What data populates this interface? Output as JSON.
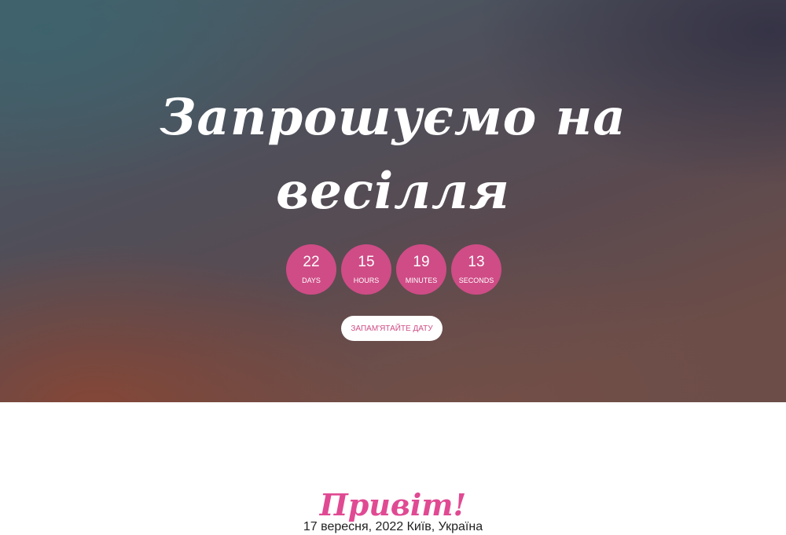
{
  "hero": {
    "title": "Запрошуємо на весілля",
    "countdown": [
      {
        "value": "22",
        "label": "DAYS"
      },
      {
        "value": "15",
        "label": "HOURS"
      },
      {
        "value": "19",
        "label": "MINUTES"
      },
      {
        "value": "13",
        "label": "SECONDS"
      }
    ],
    "button_label": "Запам'ятайте дату"
  },
  "intro": {
    "greeting": "Привіт!",
    "date_location": "17 вересня, 2022 Київ, Україна"
  },
  "colors": {
    "accent": "#cf4c86",
    "greeting": "#e04a93",
    "hero_text": "#ffffff"
  }
}
